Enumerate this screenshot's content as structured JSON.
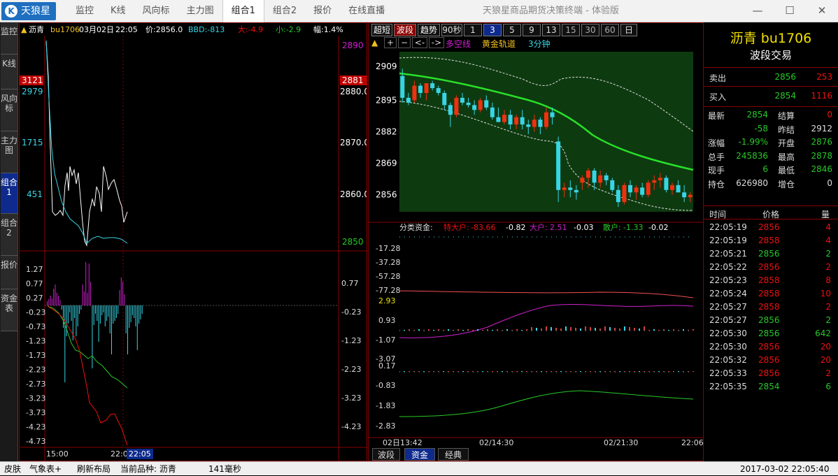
{
  "titlebar": {
    "logo": "天狼星",
    "logo_glyph": "K",
    "tabs": [
      "监控",
      "K线",
      "风向标",
      "主力图",
      "组合1",
      "组合2",
      "报价",
      "在线直播"
    ],
    "active_tab": 4,
    "title": "天狼星商品期货决策终端 - 体验版",
    "min": "—",
    "max": "☐",
    "close": "✕"
  },
  "sidebar": {
    "tabs": [
      "监控",
      "K线",
      "风向标",
      "主力图",
      "组合1",
      "组合2",
      "报价",
      "资金表"
    ],
    "active": 4
  },
  "left": {
    "header": {
      "name": "沥青",
      "code": "bu1706",
      "date": "03月02日",
      "time": "22:05",
      "price_label": "价:2856.0",
      "bbd": "BBD:-813",
      "big": "大:-4.9",
      "small": "小:-2.9",
      "amp": "幅:1.4%"
    },
    "left_ticks": [
      "2979",
      "1715",
      "451"
    ],
    "left_marker": "3121",
    "right_ticks": [
      "2880.0",
      "2870.0",
      "2860.0"
    ],
    "right_top": "2890",
    "right_bottom": "2850",
    "price_marker": "2881",
    "lower_left_ticks": [
      "1.27",
      "0.77",
      "0.27",
      "-0.23",
      "-0.73",
      "-1.23",
      "-1.73",
      "-2.23",
      "-2.73",
      "-3.23",
      "-3.73",
      "-4.23",
      "-4.73"
    ],
    "lower_right_ticks": [
      "0.77",
      "-0.23",
      "-1.23",
      "-2.23",
      "-3.23",
      "-4.23"
    ],
    "x_start": "15:00",
    "x_end": "22:0",
    "x_cursor": "22:05",
    "colors": {
      "white": "#ffffff",
      "cyan": "#37d5e6",
      "magenta": "#d020d0",
      "green": "#28c828",
      "red": "#f01010"
    }
  },
  "mid": {
    "buttons": [
      "超短",
      "波段",
      "趋势",
      "90秒",
      "1",
      "3",
      "5",
      "9",
      "13",
      "15",
      "30",
      "60",
      "日"
    ],
    "active_button": 1,
    "active_period": 5,
    "tools": [
      "▲",
      "+",
      "−",
      "<-",
      "->"
    ],
    "indicator_labels": {
      "a": "多空线",
      "b": "黄金轨道",
      "c": "3分钟"
    },
    "price_ticks": [
      "2909",
      "2895",
      "2882",
      "2869",
      "2856"
    ],
    "fund_title": "分类资金:",
    "fund_labels": [
      {
        "name": "特大户:",
        "value": "-83.66",
        "value2": "-0.82"
      },
      {
        "name": "大户:",
        "value": "2.51",
        "value2": "-0.03"
      },
      {
        "name": "散户:",
        "value": "-1.33",
        "value2": "-0.02"
      }
    ],
    "fund1_ticks": [
      "-17.28",
      "-37.28",
      "-57.28",
      "-77.28"
    ],
    "fund2_ticks": [
      "2.93",
      "0.93",
      "-1.07",
      "-3.07"
    ],
    "fund3_ticks": [
      "0.17",
      "-0.83",
      "-1.83",
      "-2.83"
    ],
    "x_labels": [
      "02日13:42",
      "02/14:30",
      "02/21:30",
      "22:06"
    ],
    "bottom_tabs": [
      "波段",
      "资金",
      "经典"
    ],
    "active_bottom": 1
  },
  "chart_data": {
    "type": "candlestick",
    "title": "沥青 bu1706 3分钟",
    "ylim": [
      2849,
      2915
    ],
    "candles": [
      [
        2905,
        2908,
        2894,
        2896
      ],
      [
        2896,
        2898,
        2893,
        2894
      ],
      [
        2895,
        2903,
        2894,
        2901
      ],
      [
        2901,
        2902,
        2896,
        2898
      ],
      [
        2898,
        2902,
        2895,
        2902
      ],
      [
        2902,
        2903,
        2899,
        2900
      ],
      [
        2900,
        2901,
        2897,
        2898
      ],
      [
        2898,
        2899,
        2891,
        2893
      ],
      [
        2893,
        2894,
        2884,
        2889
      ],
      [
        2889,
        2897,
        2888,
        2896
      ],
      [
        2896,
        2898,
        2893,
        2894
      ],
      [
        2894,
        2896,
        2892,
        2893
      ],
      [
        2893,
        2895,
        2889,
        2891
      ],
      [
        2891,
        2896,
        2890,
        2895
      ],
      [
        2895,
        2897,
        2891,
        2892
      ],
      [
        2892,
        2894,
        2887,
        2888
      ],
      [
        2888,
        2892,
        2886,
        2886
      ],
      [
        2886,
        2891,
        2885,
        2889
      ],
      [
        2889,
        2891,
        2883,
        2885
      ],
      [
        2885,
        2889,
        2883,
        2888
      ],
      [
        2888,
        2891,
        2883,
        2885
      ],
      [
        2885,
        2887,
        2881,
        2884
      ],
      [
        2884,
        2889,
        2882,
        2887
      ],
      [
        2887,
        2888,
        2881,
        2884
      ],
      [
        2884,
        2892,
        2883,
        2890
      ],
      [
        2890,
        2892,
        2885,
        2888
      ],
      [
        2878,
        2880,
        2853,
        2858
      ],
      [
        2858,
        2861,
        2855,
        2859
      ],
      [
        2859,
        2862,
        2855,
        2858
      ],
      [
        2858,
        2860,
        2854,
        2857
      ],
      [
        2861,
        2864,
        2858,
        2863
      ],
      [
        2863,
        2867,
        2859,
        2866
      ],
      [
        2866,
        2867,
        2858,
        2861
      ],
      [
        2861,
        2866,
        2859,
        2864
      ],
      [
        2864,
        2865,
        2860,
        2862
      ],
      [
        2862,
        2863,
        2857,
        2858
      ],
      [
        2858,
        2860,
        2851,
        2853
      ],
      [
        2853,
        2861,
        2852,
        2860
      ],
      [
        2860,
        2862,
        2855,
        2857
      ],
      [
        2857,
        2860,
        2854,
        2859
      ],
      [
        2859,
        2861,
        2855,
        2856
      ],
      [
        2856,
        2862,
        2855,
        2861
      ],
      [
        2861,
        2864,
        2858,
        2862
      ],
      [
        2862,
        2865,
        2859,
        2863
      ],
      [
        2863,
        2864,
        2857,
        2858
      ],
      [
        2858,
        2861,
        2856,
        2860
      ],
      [
        2860,
        2862,
        2857,
        2857
      ],
      [
        2857,
        2860,
        2853,
        2855
      ],
      [
        2855,
        2857,
        2853,
        2856
      ]
    ]
  },
  "info": {
    "name": "沥青",
    "code": "bu1706",
    "subtitle": "波段交易",
    "ask": {
      "label": "卖出",
      "price": "2856",
      "vol": "253"
    },
    "bid": {
      "label": "买入",
      "price": "2854",
      "vol": "1116"
    },
    "rows": [
      [
        "最新",
        "2854",
        "结算",
        "0"
      ],
      [
        "",
        "-58",
        "昨结",
        "2912"
      ],
      [
        "涨幅",
        "-1.99%",
        "开盘",
        "2876"
      ],
      [
        "总手",
        "245836",
        "最高",
        "2878"
      ],
      [
        "现手",
        "6",
        "最低",
        "2846"
      ],
      [
        "持仓",
        "626980",
        "增仓",
        "0"
      ]
    ],
    "trade_header": [
      "时间",
      "价格",
      "量"
    ],
    "trades": [
      [
        "22:05:19",
        "2856",
        "4",
        "r"
      ],
      [
        "22:05:19",
        "2858",
        "4",
        "r"
      ],
      [
        "22:05:21",
        "2856",
        "2",
        "g"
      ],
      [
        "22:05:22",
        "2856",
        "2",
        "r"
      ],
      [
        "22:05:23",
        "2858",
        "8",
        "r"
      ],
      [
        "22:05:24",
        "2858",
        "10",
        "r"
      ],
      [
        "22:05:27",
        "2858",
        "2",
        "r"
      ],
      [
        "22:05:27",
        "2856",
        "2",
        "g"
      ],
      [
        "22:05:30",
        "2856",
        "642",
        "g"
      ],
      [
        "22:05:30",
        "2856",
        "20",
        "r"
      ],
      [
        "22:05:32",
        "2856",
        "20",
        "r"
      ],
      [
        "22:05:33",
        "2856",
        "2",
        "r"
      ],
      [
        "22:05:35",
        "2854",
        "6",
        "g"
      ]
    ]
  },
  "status": {
    "skin": "皮肤",
    "weather": "气象表+",
    "refresh": "刷新布局",
    "current": "当前品种: 沥青",
    "ms": "141毫秒",
    "datetime": "2017-03-02 22:05:40"
  }
}
